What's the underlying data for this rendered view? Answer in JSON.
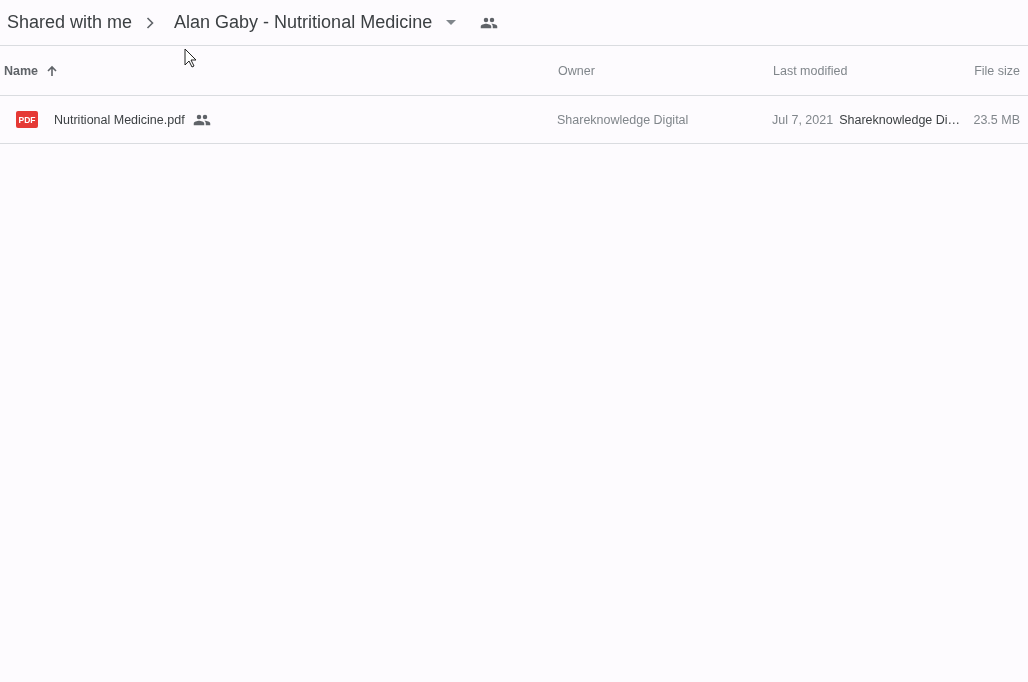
{
  "breadcrumb": [
    {
      "label": "Shared with me",
      "kind": "link"
    },
    {
      "label": "Alan Gaby - Nutritional Medicine",
      "kind": "current"
    }
  ],
  "table": {
    "columns": [
      {
        "label": "Name",
        "sorted": true
      },
      {
        "label": "Owner",
        "sorted": false
      },
      {
        "label": "Last modified",
        "sorted": false
      },
      {
        "label": "File size",
        "sorted": false
      }
    ],
    "rows": [
      {
        "name": "Nutritional Medicine.pdf",
        "file_icon": "PDF",
        "shared": true,
        "owner": "Shareknowledge Digital",
        "modified_date": "Jul 7, 2021",
        "modified_by": "Shareknowledge Di…",
        "size": "23.5 MB"
      }
    ]
  }
}
